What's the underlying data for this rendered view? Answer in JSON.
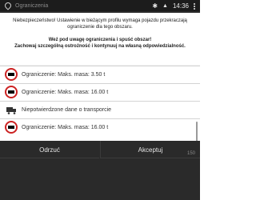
{
  "status": {
    "title": "Ograniczenia",
    "time": "14:36",
    "bt_icon": "bluetooth-icon",
    "signal_icon": "signal-icon",
    "menu_icon": "more-vert-icon",
    "pin_icon": "location-pin-icon"
  },
  "warning": {
    "p1": "Niebezpieczeństwo! Ustawienie w bieżącym profilu wymaga pojazdu przekraczają ograniczenie dla tego obszaru.",
    "p2": "Weź pod uwagę ograniczenia i spuść obszar!\nZachowaj szczególną ostrożność i kontynuuj na własną odpowiedzialność."
  },
  "restrictions": [
    {
      "label": "Ograniczenie: Maks. masa: 3.50 t",
      "icon": "weight-limit-icon"
    },
    {
      "label": "Ograniczenie: Maks. masa: 16.00 t",
      "icon": "weight-limit-icon"
    },
    {
      "label": "Niepotwierdzone dane o transporcie",
      "icon": "truck-icon"
    },
    {
      "label": "Ograniczenie: Maks. masa: 16.00 t",
      "icon": "weight-limit-icon"
    }
  ],
  "buttons": {
    "reject": "Odrzuć",
    "accept": "Akceptuj"
  },
  "footer": {
    "corner": "150"
  },
  "colors": {
    "dark_bg": "#2a2a2a",
    "statusbar_bg": "#1c1c1c",
    "warn_text": "#202020",
    "sign_red": "#cc2222"
  }
}
